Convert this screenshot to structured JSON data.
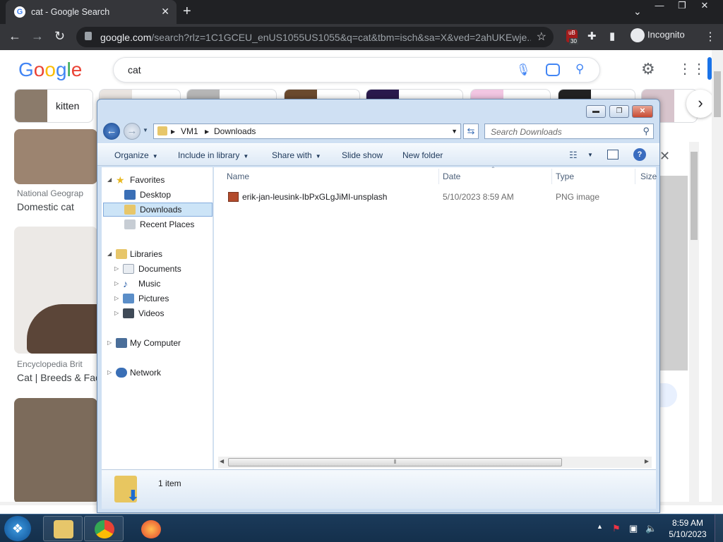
{
  "chrome": {
    "tab_title": "cat - Google Search",
    "tab_close": "✕",
    "new_tab": "+",
    "tab_menu": "⌄",
    "window_buttons": [
      "—",
      "❐",
      "✕"
    ],
    "url_host": "google.com",
    "url_rest": "/search?rlz=1C1GCEU_enUS1055US1055&q=cat&tbm=isch&sa=X&ved=2ahUKEwje...",
    "ublock_count": "30",
    "incognito_label": "Incognito",
    "icons": [
      "back-arrow-icon",
      "forward-arrow-icon",
      "reload-icon",
      "lock-icon",
      "star-icon",
      "ublock-icon",
      "puzzle-icon",
      "side-panel-icon",
      "incognito-icon",
      "kebab-menu-icon"
    ]
  },
  "google": {
    "logo": [
      "G",
      "o",
      "o",
      "g",
      "l",
      "e"
    ],
    "query": "cat",
    "chips": [
      {
        "label": "kitten"
      }
    ],
    "results": [
      {
        "source": "National Geograp",
        "title": "Domestic cat"
      },
      {
        "source": "Encyclopedia Brit",
        "title": "Cat | Breeds & Fac"
      }
    ],
    "colors": {
      "blue": "#4285f4",
      "red": "#ea4335",
      "yellow": "#fbbc05",
      "green": "#34a853"
    }
  },
  "explorer": {
    "breadcrumb": [
      "VM1",
      "Downloads"
    ],
    "search_placeholder": "Search Downloads",
    "commands": {
      "organize": "Organize",
      "include_in_library": "Include in library",
      "share_with": "Share with",
      "slide_show": "Slide show",
      "new_folder": "New folder"
    },
    "nav": {
      "favorites": "Favorites",
      "desktop": "Desktop",
      "downloads": "Downloads",
      "recent_places": "Recent Places",
      "libraries": "Libraries",
      "documents": "Documents",
      "music": "Music",
      "pictures": "Pictures",
      "videos": "Videos",
      "my_computer": "My Computer",
      "network": "Network"
    },
    "columns": {
      "name": "Name",
      "date": "Date",
      "type": "Type",
      "size": "Size"
    },
    "files": [
      {
        "name": "erik-jan-leusink-IbPxGLgJiMI-unsplash",
        "date": "5/10/2023 8:59 AM",
        "type": "PNG image"
      }
    ],
    "status": "1 item",
    "selected_nav": "Downloads"
  },
  "taskbar": {
    "start_icon": "windows-start-icon",
    "pinned": [
      "file-explorer-icon",
      "chrome-icon",
      "firefox-icon"
    ],
    "time": "8:59 AM",
    "date": "5/10/2023"
  }
}
